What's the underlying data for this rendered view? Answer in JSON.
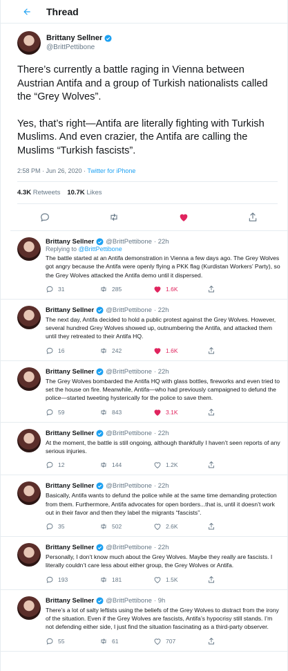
{
  "header": {
    "title": "Thread",
    "back_icon": "back-arrow-icon"
  },
  "main_tweet": {
    "name": "Brittany Sellner",
    "handle": "@BrittPettibone",
    "paragraphs": [
      "There’s currently a battle raging in Vienna between Austrian Antifa and a group of Turkish nationalists called the “Grey Wolves”.",
      "Yes, that’s right—Antifa are literally fighting with Turkish Muslims. And even crazier, the Antifa are calling the Muslims “Turkish fascists”."
    ],
    "time": "2:58 PM · Jun 26, 2020 · ",
    "source": "Twitter for iPhone",
    "retweets": "4.3K",
    "retweets_label": "Retweets",
    "likes": "10.7K",
    "likes_label": "Likes"
  },
  "colors": {
    "accent": "#1da1f2",
    "like": "#e0245e",
    "muted": "#657786"
  },
  "replies": [
    {
      "name": "Brittany Sellner",
      "handle": "@BrittPettibone",
      "age": "· 22h",
      "replying_prefix": "Replying to ",
      "replying_to": "@BrittPettibone",
      "text": "The battle started at an Antifa demonstration in Vienna a few days ago. The Grey Wolves got angry because the Antifa were openly flying a PKK flag (Kurdistan Workers’ Party), so the Grey Wolves attacked the Antifa demo until it dispersed.",
      "replies": "31",
      "retweets": "285",
      "likes": "1.6K",
      "liked": true
    },
    {
      "name": "Brittany Sellner",
      "handle": "@BrittPettibone",
      "age": "· 22h",
      "text": "The next day, Antifa decided to hold a public protest against the Grey Wolves. However, several hundred Grey Wolves showed up, outnumbering the Antifa, and attacked them until they retreated to their Antifa HQ.",
      "replies": "16",
      "retweets": "242",
      "likes": "1.6K",
      "liked": true
    },
    {
      "name": "Brittany Sellner",
      "handle": "@BrittPettibone",
      "age": "· 22h",
      "text": "The Grey Wolves bombarded the Antifa HQ with glass bottles, fireworks and even tried to set the house on fire. Meanwhile, Antifa—who had previously campaigned to defund the police—started tweeting hysterically for the police to save them.",
      "replies": "59",
      "retweets": "843",
      "likes": "3.1K",
      "liked": true
    },
    {
      "name": "Brittany Sellner",
      "handle": "@BrittPettibone",
      "age": "· 22h",
      "text": "At the moment, the battle is still ongoing, although thankfully I haven’t seen reports of any serious injuries.",
      "replies": "12",
      "retweets": "144",
      "likes": "1.2K",
      "liked": false
    },
    {
      "name": "Brittany Sellner",
      "handle": "@BrittPettibone",
      "age": "· 22h",
      "text": "Basically, Antifa wants to defund the police while at the same time demanding protection from them. Furthermore, Antifa advocates for open borders...that is, until it doesn’t work out in their favor and then they label the migrants “fascists”.",
      "replies": "35",
      "retweets": "502",
      "likes": "2.6K",
      "liked": false
    },
    {
      "name": "Brittany Sellner",
      "handle": "@BrittPettibone",
      "age": "· 22h",
      "text": "Personally, I don’t know much about the Grey Wolves. Maybe they really are fascists. I literally couldn’t care less about either group, the Grey Wolves or Antifa.",
      "replies": "193",
      "retweets": "181",
      "likes": "1.5K",
      "liked": false
    },
    {
      "name": "Brittany Sellner",
      "handle": "@BrittPettibone",
      "age": "· 9h",
      "text": "There’s a lot of salty leftists using the beliefs of the Grey Wolves to distract from the irony of the situation. Even if the Grey Wolves are fascists, Antifa’s hypocrisy still stands. I’m not defending either side, I just find the situation fascinating as a third-party observer.",
      "replies": "55",
      "retweets": "61",
      "likes": "707",
      "liked": false
    }
  ]
}
